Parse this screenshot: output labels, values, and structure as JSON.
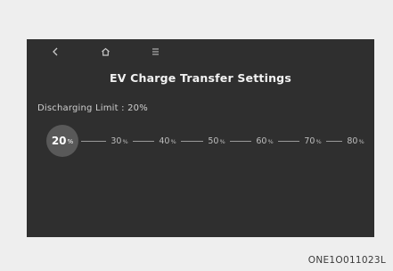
{
  "nav": {
    "back_icon": "chevron-left-icon",
    "home_icon": "home-icon",
    "menu_icon": "menu-icon"
  },
  "title": "EV Charge Transfer Settings",
  "limit_label": "Discharging Limit : 20%",
  "slider": {
    "selected_value": 20,
    "steps": [
      {
        "value": "20",
        "unit": "%"
      },
      {
        "value": "30",
        "unit": "%"
      },
      {
        "value": "40",
        "unit": "%"
      },
      {
        "value": "50",
        "unit": "%"
      },
      {
        "value": "60",
        "unit": "%"
      },
      {
        "value": "70",
        "unit": "%"
      },
      {
        "value": "80",
        "unit": "%"
      }
    ]
  },
  "caption": "ONE1O011023L",
  "colors": {
    "screen_bg": "#2f2f2f",
    "selected_bg": "#595959",
    "text": "#f2f2f2"
  }
}
